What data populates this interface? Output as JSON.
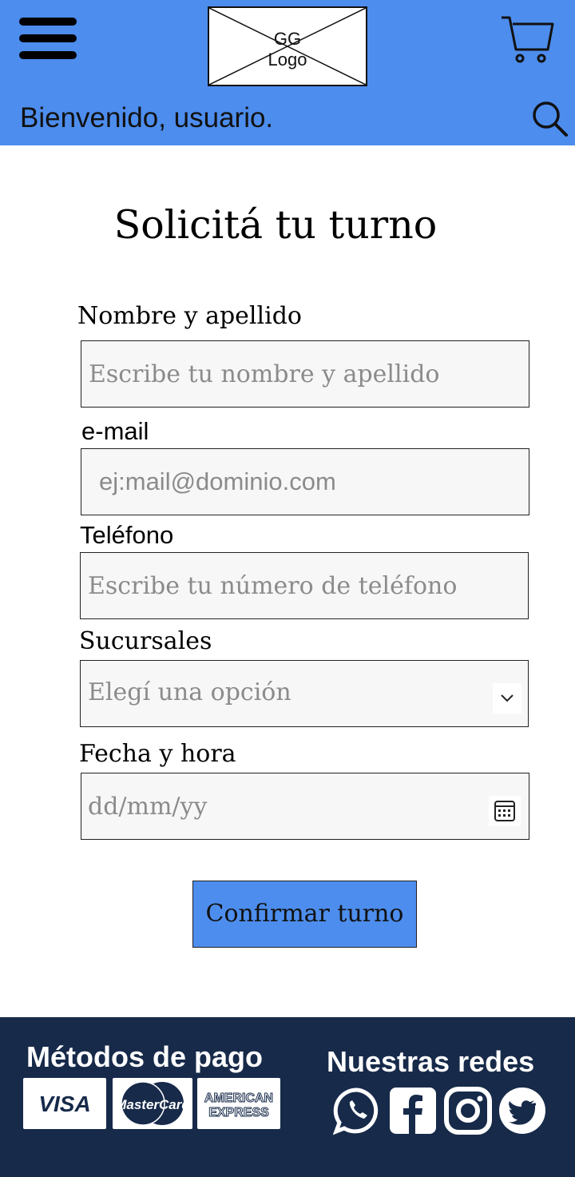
{
  "header": {
    "logo_text": "GG\nLogo",
    "welcome": "Bienvenido, usuario."
  },
  "main": {
    "title": "Solicitá tu turno",
    "form": {
      "name_label": "Nombre y apellido",
      "name_placeholder": "Escribe tu nombre y apellido",
      "email_label": "e-mail",
      "email_placeholder": "ej:mail@dominio.com",
      "phone_label": "Teléfono",
      "phone_placeholder": "Escribe tu número de teléfono",
      "branch_label": "Sucursales",
      "branch_selected": "Elegí una opción",
      "datetime_label": "Fecha y hora",
      "datetime_placeholder": "dd/mm/yy",
      "confirm_label": "Confirmar turno"
    }
  },
  "footer": {
    "payments_title": "Métodos de pago",
    "payments": [
      "VISA",
      "MasterCard",
      "AMERICAN",
      "EXPRESS"
    ],
    "social_title": "Nuestras redes",
    "social_icons": [
      "whatsapp-icon",
      "facebook-icon",
      "instagram-icon",
      "twitter-icon"
    ]
  },
  "colors": {
    "brand_blue": "#4d8ded",
    "footer_navy": "#172a4a"
  }
}
